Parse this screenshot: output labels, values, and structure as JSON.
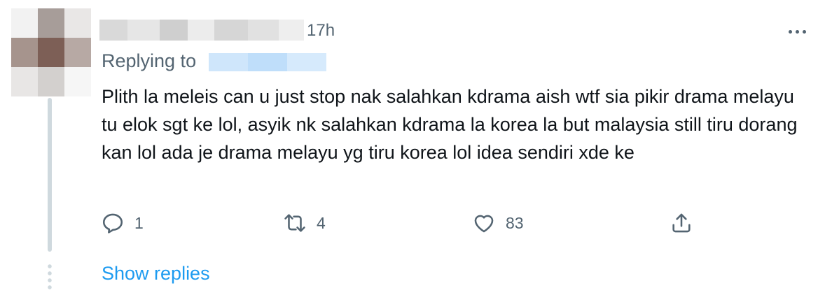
{
  "tweet": {
    "time": "17h",
    "replying_to_label": "Replying to",
    "text": "Plith la meleis can u just stop nak salahkan kdrama aish wtf sia pikir drama melayu tu elok sgt ke lol, asyik nk salahkan kdrama la korea la but malaysia still tiru dorang kan lol ada je drama melayu yg tiru korea lol idea sendiri xde ke",
    "more_icon": "more-horizontal-icon"
  },
  "actions": {
    "reply": {
      "icon": "reply-icon",
      "count": "1"
    },
    "retweet": {
      "icon": "retweet-icon",
      "count": "4"
    },
    "like": {
      "icon": "heart-icon",
      "count": "83"
    },
    "share": {
      "icon": "share-icon",
      "count": ""
    }
  },
  "footer": {
    "show_replies_label": "Show replies"
  },
  "colors": {
    "text": "#0f1419",
    "secondary": "#536471",
    "link": "#1d9bf0",
    "thread_line": "#cfd9de"
  }
}
